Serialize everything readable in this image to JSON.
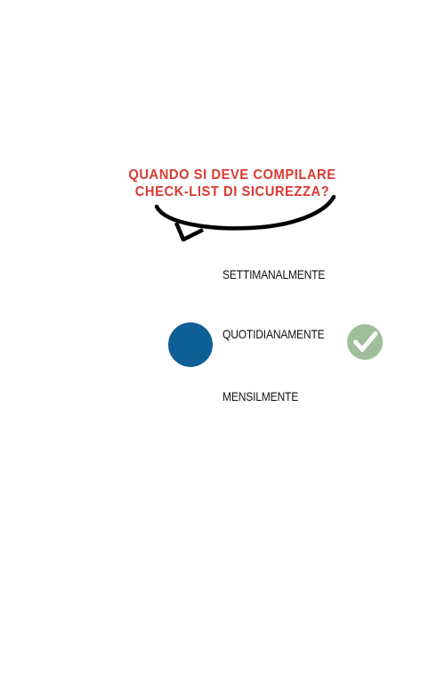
{
  "question": {
    "line1": "QUANDO SI DEVE COMPILARE",
    "line2": "CHECK-LIST DI SICUREZZA?"
  },
  "options": [
    {
      "label": "SETTIMANALMENTE",
      "selected": false,
      "correct": false
    },
    {
      "label": "QUOTIDIANAMENTE",
      "selected": true,
      "correct": true
    },
    {
      "label": "MENSILMENTE",
      "selected": false,
      "correct": false
    }
  ],
  "icons": {
    "selection": "filled-circle-icon",
    "correct": "check-icon"
  },
  "colors": {
    "question_text": "#d93a33",
    "bubble_stroke": "#000000",
    "selected_dot": "#0e5f96",
    "check_badge": "#9fbe9a",
    "check_mark": "#ffffff"
  }
}
